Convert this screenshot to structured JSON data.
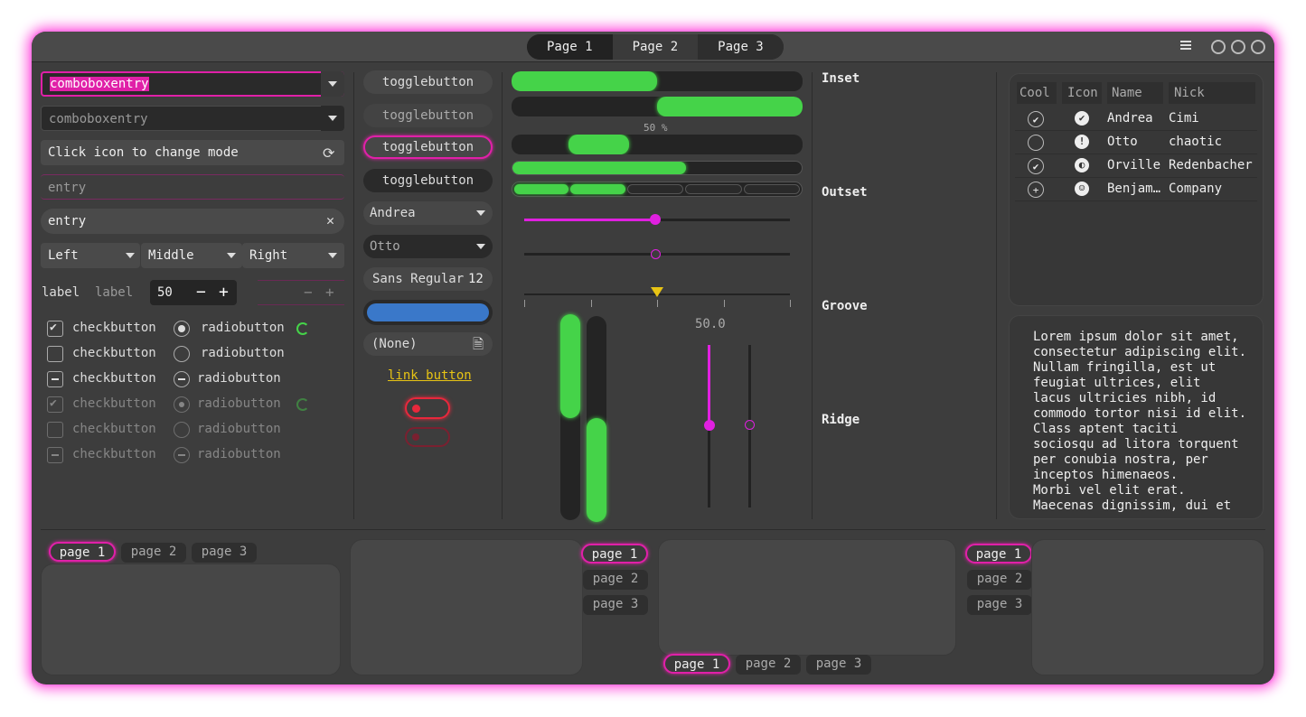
{
  "header": {
    "tabs": [
      "Page 1",
      "Page 2",
      "Page 3"
    ]
  },
  "left": {
    "combo1": "comboboxentry",
    "combo2": "comboboxentry",
    "entry_icon": "Click icon to change mode",
    "entry_placeholder": "entry",
    "entry_text": "entry",
    "combos": [
      "Left",
      "Middle",
      "Right"
    ],
    "label1": "label",
    "label2": "label",
    "spin_value": "50",
    "checks": [
      "checkbutton",
      "checkbutton",
      "checkbutton",
      "checkbutton",
      "checkbutton",
      "checkbutton"
    ],
    "radios": [
      "radiobutton",
      "radiobutton",
      "radiobutton",
      "radiobutton",
      "radiobutton",
      "radiobutton"
    ]
  },
  "middle": {
    "toggles": [
      "togglebutton",
      "togglebutton",
      "togglebutton",
      "togglebutton"
    ],
    "combo_andrea": "Andrea",
    "combo_otto": "Otto",
    "font_name": "Sans Regular",
    "font_size": "12",
    "file_none": "(None)",
    "link": "link button"
  },
  "progress": {
    "label": "50 %",
    "scale_value": "50.0",
    "bars": [
      0.5,
      0.5,
      0.2,
      0.6,
      0.4
    ]
  },
  "frames": [
    "Inset",
    "Outset",
    "Groove",
    "Ridge"
  ],
  "tree": {
    "headers": [
      "Cool",
      "Icon",
      "Name",
      "Nick"
    ],
    "rows": [
      {
        "name": "Andrea",
        "nick": "Cimi"
      },
      {
        "name": "Otto",
        "nick": "chaotic"
      },
      {
        "name": "Orville",
        "nick": "Redenbacher"
      },
      {
        "name": "Benjam…",
        "nick": "Company"
      }
    ]
  },
  "textview": "Lorem ipsum dolor sit amet,\nconsectetur adipiscing elit.\nNullam fringilla, est ut\nfeugiat ultrices, elit\nlacus ultricies nibh, id\ncommodo tortor nisi id elit.\nClass aptent taciti\nsociosqu ad litora torquent\nper conubia nostra, per\ninceptos himenaeos.\nMorbi vel elit erat.\nMaecenas dignissim, dui et",
  "notebooks": {
    "tabs": [
      "page 1",
      "page 2",
      "page 3"
    ]
  },
  "colors": {
    "accent": "#e020a8",
    "green": "#45d349",
    "blue": "#3a78c9",
    "red": "#e8283c",
    "yellow": "#e8c414"
  }
}
